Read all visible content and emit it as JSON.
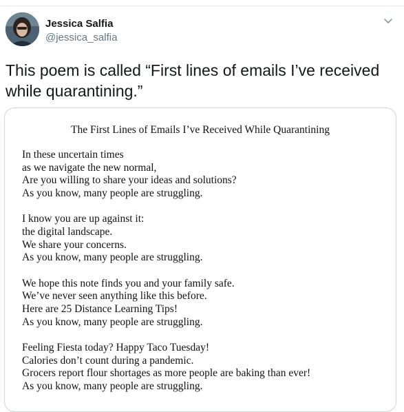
{
  "user": {
    "display_name": "Jessica Salfia",
    "handle": "@jessica_salfia",
    "avatar": "profile-photo"
  },
  "tweet": {
    "text": "This poem is called “First lines of emails I’ve received while quarantining.”",
    "menu_icon": "chevron-down-icon"
  },
  "image": {
    "title": "The First Lines of Emails I’ve Received While Quarantining",
    "stanzas": [
      {
        "lines": [
          "In these uncertain times",
          "as we navigate the new normal,",
          "Are you willing to share your ideas and solutions?",
          "As you know, many people are struggling."
        ]
      },
      {
        "lines": [
          "I know you are up against it:",
          "the digital landscape.",
          "We share your concerns.",
          "As you know, many people are struggling."
        ]
      },
      {
        "lines": [
          "We hope this note finds you and your family safe.",
          "We’ve never seen anything like this before.",
          "Here are 25 Distance Learning Tips!",
          "As you know, many people are struggling."
        ]
      },
      {
        "lines": [
          "Feeling Fiesta today? Happy Taco Tuesday!",
          "Calories don’t count during a pandemic.",
          "Grocers report flour shortages as more people are baking than ever!",
          "As you know, many people are struggling."
        ]
      }
    ]
  },
  "colors": {
    "text_primary": "#14171a",
    "text_secondary": "#657786",
    "border": "#ccd6dd"
  }
}
